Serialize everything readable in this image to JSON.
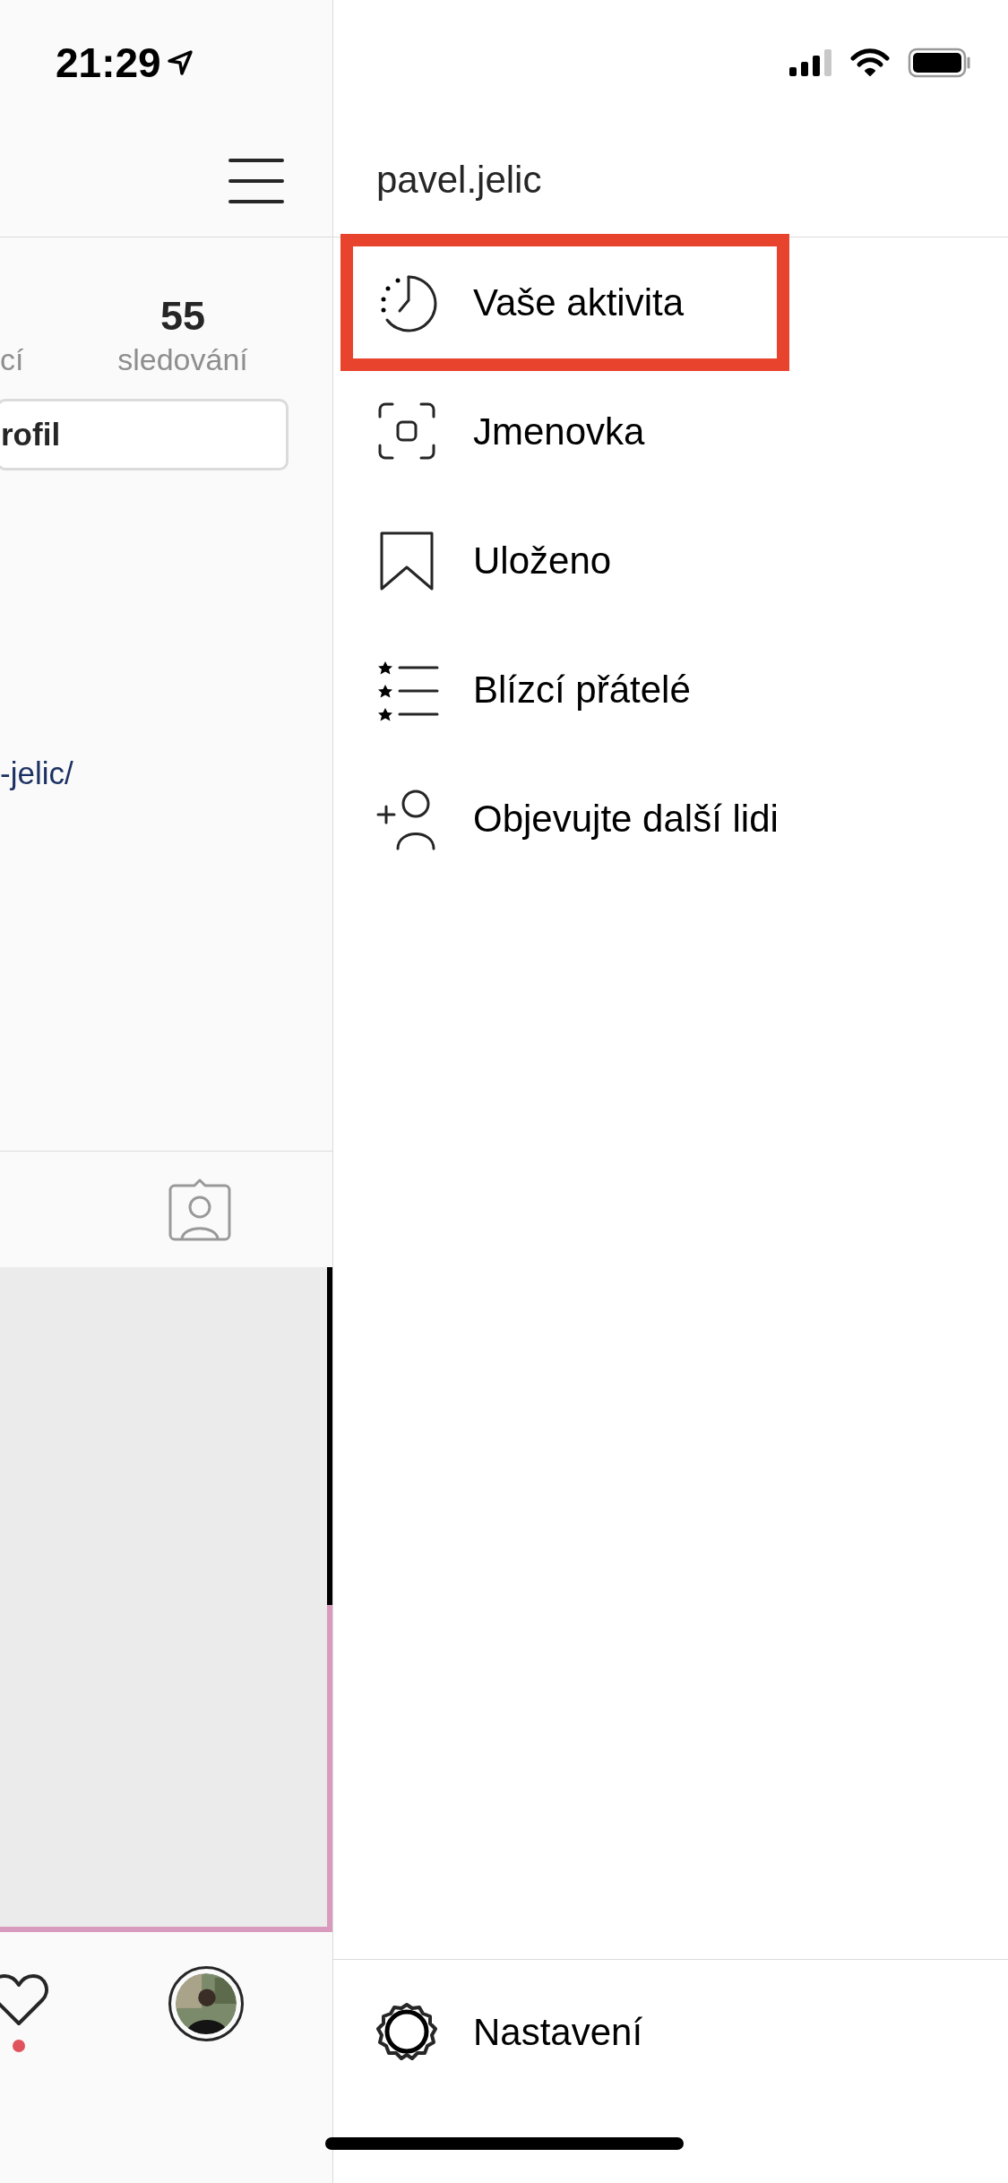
{
  "status_bar": {
    "time": "21:29"
  },
  "profile": {
    "stats": [
      {
        "label": "cí"
      },
      {
        "value": "55",
        "label": "sledování"
      }
    ],
    "edit_button": {
      "label": "rofil"
    },
    "link": "-jelic/"
  },
  "bottom_nav": {
    "activity_dot": true
  },
  "menu": {
    "username": "pavel.jelic",
    "items": [
      {
        "kind": "activity",
        "label": "Vaše aktivita",
        "highlighted": true
      },
      {
        "kind": "nametag",
        "label": "Jmenovka",
        "highlighted": false
      },
      {
        "kind": "saved",
        "label": "Uloženo",
        "highlighted": false
      },
      {
        "kind": "close_friends",
        "label": "Blízcí přátelé",
        "highlighted": false
      },
      {
        "kind": "discover",
        "label": "Objevujte další lidi",
        "highlighted": false
      }
    ],
    "footer": {
      "kind": "settings",
      "label": "Nastavení"
    }
  }
}
